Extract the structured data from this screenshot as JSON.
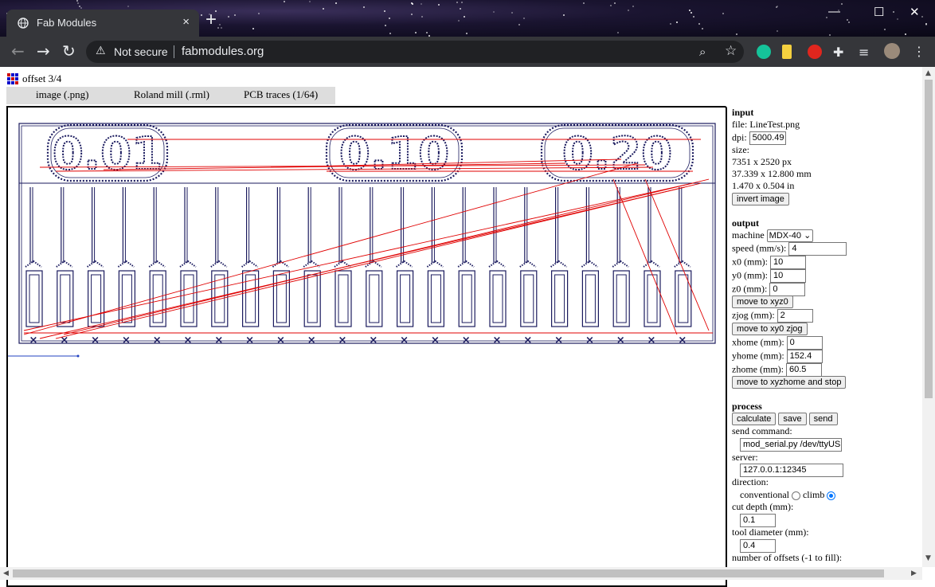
{
  "browser": {
    "tab_title": "Fab Modules",
    "tab_close": "×",
    "new_tab": "+",
    "window_minimize": "—",
    "window_maximize": "☐",
    "window_close": "✕",
    "security_label": "Not secure",
    "url": "fabmodules.org"
  },
  "app": {
    "name": "offset 3/4",
    "menu": [
      "image (.png)",
      "Roland mill (.rml)",
      "PCB traces (1/64)"
    ]
  },
  "input": {
    "heading": "input",
    "file_label": "file: LineTest.png",
    "dpi_label": "dpi:",
    "dpi_value": "5000.49",
    "size_label": "size:",
    "size_px": "7351 x 2520 px",
    "size_mm": "37.339 x 12.800 mm",
    "size_in": "1.470 x 0.504 in",
    "invert_button": "invert image"
  },
  "output": {
    "heading": "output",
    "machine_label": "machine",
    "machine_value": "MDX-40",
    "speed_label": "speed (mm/s):",
    "speed_value": "4",
    "x0_label": "x0 (mm):",
    "x0_value": "10",
    "y0_label": "y0 (mm):",
    "y0_value": "10",
    "z0_label": "z0 (mm):",
    "z0_value": "0",
    "move_xyz0_button": "move to xyz0",
    "zjog_label": "zjog (mm):",
    "zjog_value": "2",
    "move_xy0_button": "move to xy0 zjog",
    "xhome_label": "xhome (mm):",
    "xhome_value": "0",
    "yhome_label": "yhome (mm):",
    "yhome_value": "152.4",
    "zhome_label": "zhome (mm):",
    "zhome_value": "60.5",
    "move_home_button": "move to xyzhome and stop"
  },
  "process": {
    "heading": "process",
    "calculate_button": "calculate",
    "save_button": "save",
    "send_button": "send",
    "send_command_label": "send command:",
    "send_command_value": "mod_serial.py /dev/ttyUSE",
    "server_label": "server:",
    "server_value": "127.0.0.1:12345",
    "direction_label": "direction:",
    "conventional_label": "conventional",
    "climb_label": "climb",
    "direction_selected": "climb",
    "cut_depth_label": "cut depth (mm):",
    "cut_depth_value": "0.1",
    "tool_diameter_label": "tool diameter (mm):",
    "tool_diameter_value": "0.4",
    "offsets_label": "number of offsets (-1 to fill):"
  },
  "canvas": {
    "labels": [
      "0.01",
      "0.10",
      "0.20"
    ],
    "path_color": "#1a1a5e",
    "move_color": "#e00000"
  }
}
